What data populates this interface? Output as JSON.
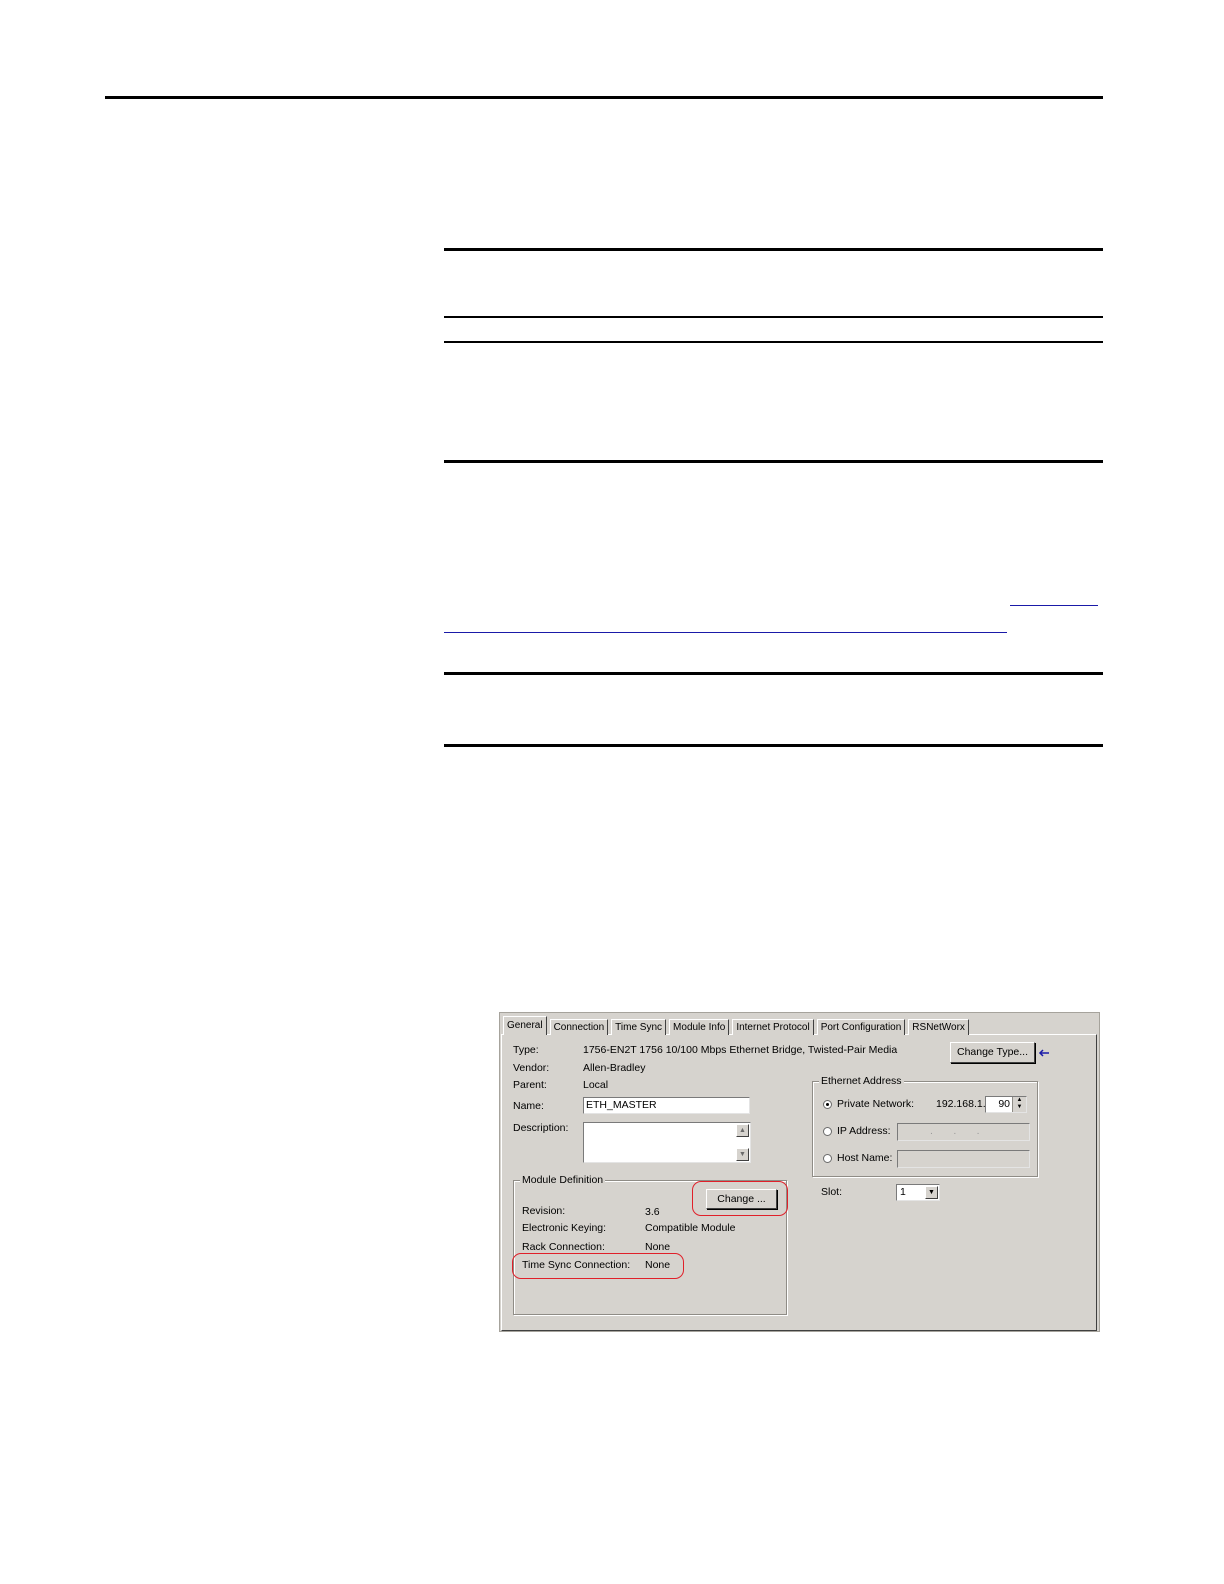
{
  "dialog": {
    "tabs": [
      "General",
      "Connection",
      "Time Sync",
      "Module Info",
      "Internet Protocol",
      "Port Configuration",
      "RSNetWorx"
    ],
    "type_label": "Type:",
    "type_value": "1756-EN2T 1756 10/100 Mbps Ethernet Bridge, Twisted-Pair Media",
    "vendor_label": "Vendor:",
    "vendor_value": "Allen-Bradley",
    "parent_label": "Parent:",
    "parent_value": "Local",
    "name_label": "Name:",
    "name_value": "ETH_MASTER",
    "description_label": "Description:",
    "change_type_button": "Change Type...",
    "module_definition": {
      "title": "Module Definition",
      "change_button": "Change ...",
      "revision_label": "Revision:",
      "revision_value": "3.6",
      "keying_label": "Electronic Keying:",
      "keying_value": "Compatible Module",
      "rack_label": "Rack Connection:",
      "rack_value": "None",
      "timesync_label": "Time Sync Connection:",
      "timesync_value": "None"
    },
    "ethernet_address": {
      "title": "Ethernet Address",
      "private_network_label": "Private Network:",
      "private_prefix": "192.168.1.",
      "private_value": "90",
      "ip_address_label": "IP Address:",
      "ip_placeholder": ".       .       .",
      "host_name_label": "Host Name:"
    },
    "slot_label": "Slot:",
    "slot_value": "1"
  },
  "colors": {
    "dialog_bg": "#d6d3ce",
    "highlight_oval": "#e0202a",
    "arrow": "#1a1aa8"
  }
}
